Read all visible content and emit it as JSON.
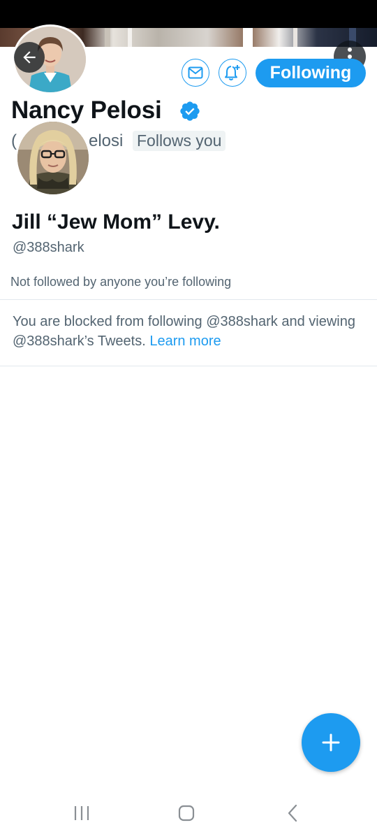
{
  "profile": {
    "name": "Nancy Pelosi",
    "handle_partial_left": "(",
    "handle_partial_right": "elosi",
    "follows_you": "Follows you",
    "following_label": "Following"
  },
  "blocked_account": {
    "name": "Jill “Jew Mom” Levy.",
    "handle": "@388shark",
    "mutual_text": "Not followed by anyone you’re following",
    "blocked_text": "You are blocked from following @388shark and viewing @388shark’s Tweets.",
    "learn_more": "Learn more"
  },
  "colors": {
    "accent": "#1d9bf0",
    "text_primary": "#0f1419",
    "text_secondary": "#536471"
  },
  "icons": {
    "back": "arrow-left-icon",
    "more": "more-vertical-icon",
    "message": "envelope-icon",
    "notify": "bell-plus-icon",
    "verified": "verified-badge-icon",
    "compose": "plus-icon",
    "nav_recent": "recent-apps-icon",
    "nav_home": "home-icon",
    "nav_back": "chevron-left-icon"
  }
}
